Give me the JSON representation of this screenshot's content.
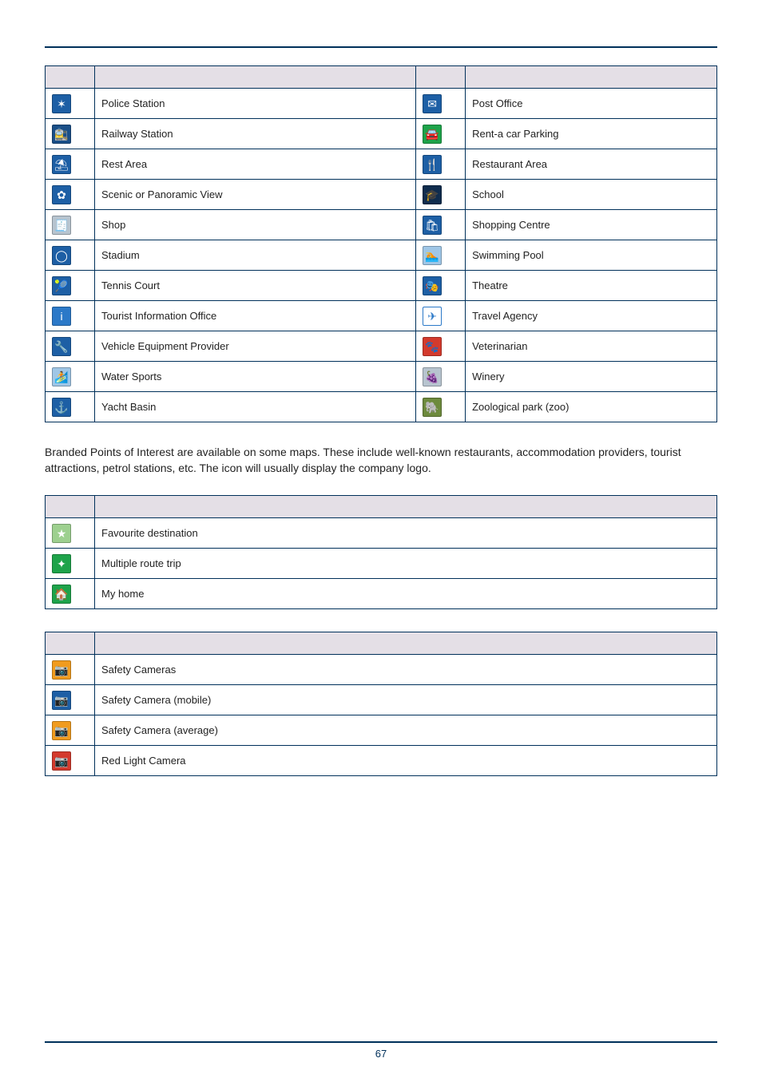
{
  "poi_table": {
    "rows": [
      {
        "left": {
          "label": "Police Station",
          "glyph": "✶",
          "css": "bg-navy"
        },
        "right": {
          "label": "Post Office",
          "glyph": "✉",
          "css": "bg-navy"
        }
      },
      {
        "left": {
          "label": "Railway Station",
          "glyph": "🚉",
          "css": "bg-navy2"
        },
        "right": {
          "label": "Rent-a car Parking",
          "glyph": "🚘",
          "css": "bg-green"
        }
      },
      {
        "left": {
          "label": "Rest Area",
          "glyph": "⛱",
          "css": "bg-navy"
        },
        "right": {
          "label": "Restaurant Area",
          "glyph": "🍴",
          "css": "bg-navy"
        }
      },
      {
        "left": {
          "label": "Scenic or Panoramic View",
          "glyph": "✿",
          "css": "bg-navy"
        },
        "right": {
          "label": "School",
          "glyph": "🎓",
          "css": "bg-dnavy"
        }
      },
      {
        "left": {
          "label": "Shop",
          "glyph": "🧾",
          "css": "bg-gray"
        },
        "right": {
          "label": "Shopping Centre",
          "glyph": "🛍",
          "css": "bg-navy"
        }
      },
      {
        "left": {
          "label": "Stadium",
          "glyph": "◯",
          "css": "bg-navy"
        },
        "right": {
          "label": "Swimming Pool",
          "glyph": "🏊",
          "css": "bg-ltblue"
        }
      },
      {
        "left": {
          "label": "Tennis Court",
          "glyph": "🎾",
          "css": "bg-navy"
        },
        "right": {
          "label": "Theatre",
          "glyph": "🎭",
          "css": "bg-navy"
        }
      },
      {
        "left": {
          "label": "Tourist Information Office",
          "glyph": "i",
          "css": "bg-blue2"
        },
        "right": {
          "label": "Travel Agency",
          "glyph": "✈",
          "css": "bg-white"
        }
      },
      {
        "left": {
          "label": "Vehicle Equipment Provider",
          "glyph": "🔧",
          "css": "bg-navy"
        },
        "right": {
          "label": "Veterinarian",
          "glyph": "🐾",
          "css": "bg-red"
        }
      },
      {
        "left": {
          "label": "Water Sports",
          "glyph": "🏄",
          "css": "bg-ltblue"
        },
        "right": {
          "label": "Winery",
          "glyph": "🍇",
          "css": "bg-gray"
        }
      },
      {
        "left": {
          "label": "Yacht Basin",
          "glyph": "⚓",
          "css": "bg-navy"
        },
        "right": {
          "label": "Zoological park (zoo)",
          "glyph": "🐘",
          "css": "bg-olive"
        }
      }
    ]
  },
  "branded_text": "Branded Points of Interest are available on some maps. These include well-known restaurants, accommodation providers, tourist attractions, petrol stations, etc. The icon will usually display the company logo.",
  "favorites_table": {
    "rows": [
      {
        "label": "Favourite destination",
        "glyph": "★",
        "css": "bg-ltgreen"
      },
      {
        "label": "Multiple route trip",
        "glyph": "✦",
        "css": "bg-green"
      },
      {
        "label": "My home",
        "glyph": "🏠",
        "css": "bg-green"
      }
    ]
  },
  "cameras_table": {
    "rows": [
      {
        "label": "Safety Cameras",
        "glyph": "📷",
        "css": "bg-orange"
      },
      {
        "label": "Safety Camera (mobile)",
        "glyph": "📷",
        "css": "bg-navy"
      },
      {
        "label": "Safety Camera (average)",
        "glyph": "📷",
        "css": "bg-orange"
      },
      {
        "label": "Red Light Camera",
        "glyph": "📷",
        "css": "bg-red"
      }
    ]
  },
  "page_number": "67"
}
